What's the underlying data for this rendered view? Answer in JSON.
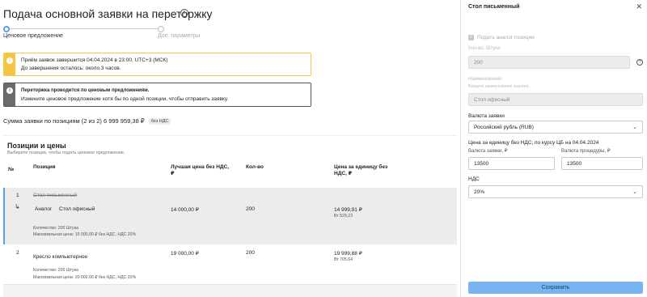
{
  "page": {
    "title": "Подача основной заявки на переторжку",
    "steps": [
      "Ценовое предложение",
      "Доп. параметры"
    ]
  },
  "alerts": {
    "deadline": {
      "line1": "Приём заявок завершится 04.04.2024 в 23:00, UTC+3 (МСК)",
      "line2": "До завершения осталось: около 3 часов."
    },
    "notice": {
      "line1": "Переторжка проводится по ценовым предложениям.",
      "line2": "Измените ценовое предложение хотя бы по одной позиции, чтобы отправить заявку."
    }
  },
  "summary": {
    "text": "Сумма заявки по позициям (2 из 2) 6 999 959,38 ₽",
    "badge": "без НДС"
  },
  "positions": {
    "title": "Позиции и цены",
    "subtitle": "Выберите позиции, чтобы подать ценовое предложение.",
    "columns": {
      "num": "№",
      "position": "Позиция",
      "best_price_l1": "Лучшая цена без НДС,",
      "best_price_l2": "₽",
      "qty": "Кол-во",
      "unit_price_l1": "Цена за единицу без",
      "unit_price_l2": "НДС, ₽"
    },
    "rows": [
      {
        "num": "1",
        "name": "Стол письменный",
        "analog_label": "Аналог",
        "analog_name": "Стол офисный",
        "best_price": "14 000,00 ₽",
        "qty": "200",
        "unit_price": "14 999,91 ₽",
        "vat": "Вт 529,23",
        "detail1": "Количество: 200 Штука",
        "detail2": "Максимальная цена: 15 000,00 ₽ без НДС, НДС 20%"
      },
      {
        "num": "2",
        "name": "Кресло компьютерное",
        "best_price": "19 000,00 ₽",
        "qty": "200",
        "unit_price": "19 999,88 ₽",
        "vat": "Вт 705,64",
        "detail1": "Количество: 200 Штука",
        "detail2": "Максимальная цена: 20 000,00 ₽ без НДС, НДС 20%"
      }
    ]
  },
  "panel": {
    "title": "Стол письменный",
    "analog_checkbox_label": "Подать аналог позиции",
    "analog_checked": true,
    "qty_label": "Кол-во, Штука",
    "qty_value": "200",
    "name_label": "Наименование",
    "name_hint": "Введите наименование аналога",
    "name_value": "Стол офисный",
    "currency_label": "Валюта заявки",
    "currency_value": "Российский рубль (RUB)",
    "price_heading": "Цена за единицу без НДС, по курсу ЦБ на 04.04.2024",
    "bid_currency_label": "Валюта заявки, ₽",
    "bid_currency_value": "13500",
    "proc_currency_label": "Валюта процедуры, ₽",
    "proc_currency_value": "13500",
    "vat_label": "НДС",
    "vat_value": "20%",
    "save_label": "Сохранить"
  },
  "colors": {
    "accent": "#5aa0e6",
    "save_button": "#78b5f0",
    "warning": "#f5c542",
    "notice": "#6b6b6b"
  }
}
